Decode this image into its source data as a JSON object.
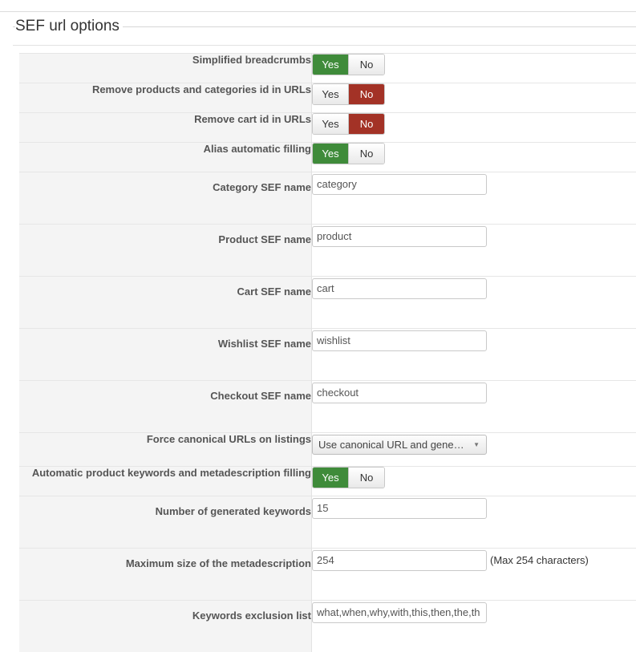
{
  "section": {
    "title": "SEF url options"
  },
  "toggle_labels": {
    "yes": "Yes",
    "no": "No"
  },
  "rows": {
    "simplified_breadcrumbs": {
      "label": "Simplified breadcrumbs",
      "value": "Yes"
    },
    "remove_ids": {
      "label": "Remove products and categories id in URLs",
      "value": "No"
    },
    "remove_cart_id": {
      "label": "Remove cart id in URLs",
      "value": "No"
    },
    "alias_auto": {
      "label": "Alias automatic filling",
      "value": "Yes"
    },
    "category_sef": {
      "label": "Category SEF name",
      "value": "category"
    },
    "product_sef": {
      "label": "Product SEF name",
      "value": "product"
    },
    "cart_sef": {
      "label": "Cart SEF name",
      "value": "cart"
    },
    "wishlist_sef": {
      "label": "Wishlist SEF name",
      "value": "wishlist"
    },
    "checkout_sef": {
      "label": "Checkout SEF name",
      "value": "checkout"
    },
    "force_canonical": {
      "label": "Force canonical URLs on listings",
      "value": "Use canonical URL and gene…"
    },
    "auto_keywords": {
      "label": "Automatic product keywords and metadescription filling",
      "value": "Yes"
    },
    "num_keywords": {
      "label": "Number of generated keywords",
      "value": "15"
    },
    "max_meta": {
      "label": "Maximum size of the metadescription",
      "value": "254",
      "hint": "(Max 254 characters)"
    },
    "keywords_exclusion": {
      "label": "Keywords exclusion list",
      "value": "what,when,why,with,this,then,the,th"
    }
  },
  "colors": {
    "yes_active": "#3f8b3a",
    "no_active": "#a33226"
  }
}
